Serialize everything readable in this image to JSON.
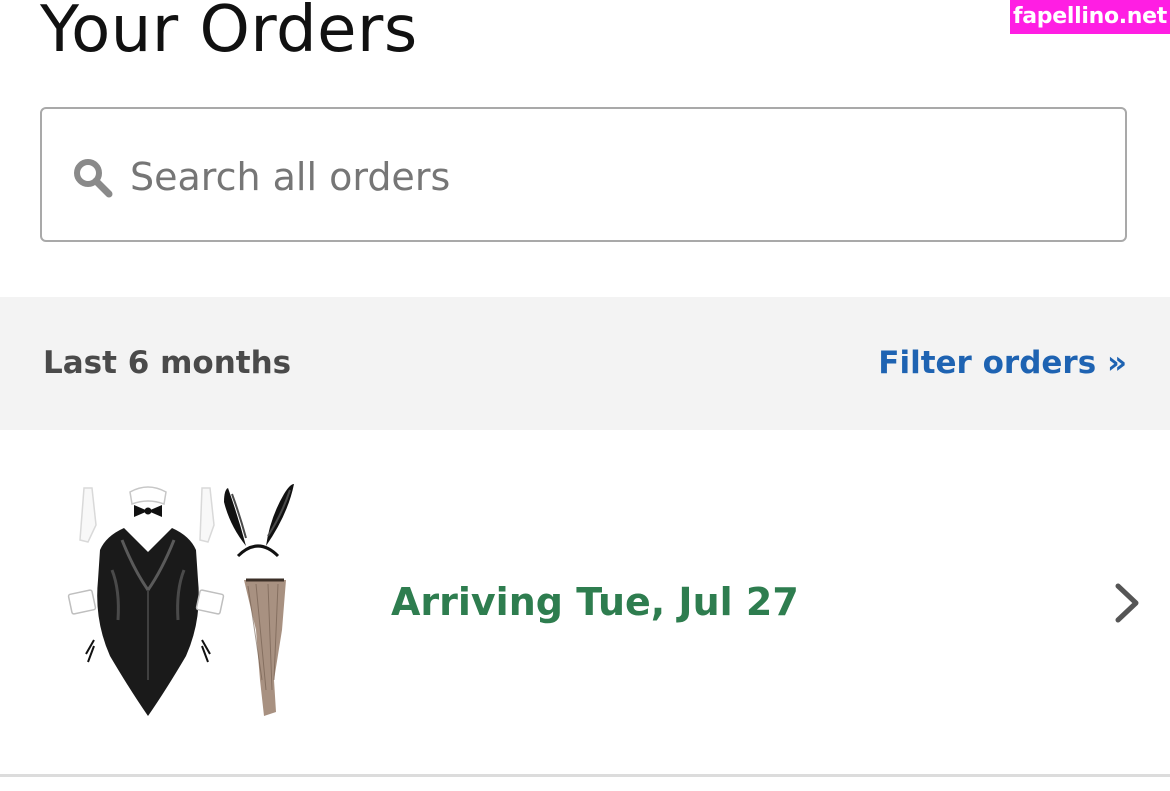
{
  "watermark": {
    "text": "fapellino.net"
  },
  "header": {
    "title": "Your Orders"
  },
  "search": {
    "placeholder": "Search all orders",
    "value": "",
    "icon": "search-icon"
  },
  "filter_bar": {
    "range_label": "Last 6 months",
    "filter_link": "Filter orders »"
  },
  "orders": [
    {
      "status": "Arriving Tue, Jul 27",
      "image": "bunny-costume-product-image",
      "action_icon": "chevron-right-icon"
    }
  ],
  "colors": {
    "link_blue": "#1e63b2",
    "arriving_green": "#2e7d4f",
    "filter_bar_bg": "#f3f3f3",
    "watermark_bg": "#ff1ee3"
  }
}
